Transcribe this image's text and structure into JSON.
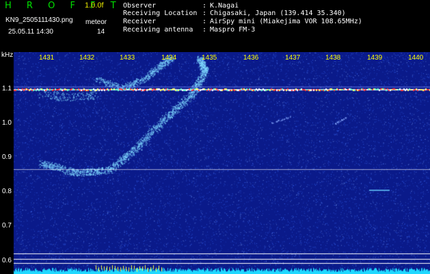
{
  "header": {
    "app_title": "H R O F F T",
    "version": "1.0.0f",
    "filename": "KN9_2505111430.png",
    "mode": "meteor",
    "datetime": "25.05.11 14:30",
    "count": "14"
  },
  "station_info": [
    {
      "key": "Observer",
      "value": "K.Nagai"
    },
    {
      "key": "Receiving Location",
      "value": "Chigasaki, Japan (139.414 35.340)"
    },
    {
      "key": "Receiver",
      "value": "AirSpy mini (Miakejima VOR 108.65MHz)"
    },
    {
      "key": "Receiving antenna",
      "value": "Maspro FM-3"
    }
  ],
  "spectrogram": {
    "freq_unit": "kHz",
    "time_ticks": [
      "1431",
      "1432",
      "1433",
      "1434",
      "1435",
      "1436",
      "1437",
      "1438",
      "1439",
      "1440"
    ],
    "freq_ticks": [
      "1.1",
      "1.0",
      "0.9",
      "0.8",
      "0.7",
      "0.6"
    ],
    "colors": {
      "background": "#0a1a8a",
      "noise": "#2f56ff",
      "carrier": "#ffffff",
      "carrier_hot": "#ff3a3a",
      "echo": "#7fd8ff",
      "baseline_noise": "#20d8ff",
      "axis_text": "#ffff00"
    }
  }
}
